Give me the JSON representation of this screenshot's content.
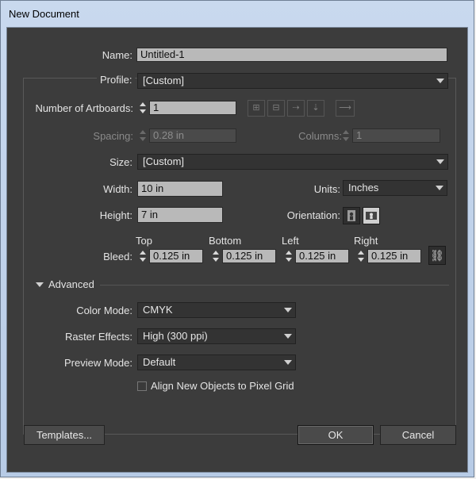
{
  "window": {
    "title": "New Document"
  },
  "name": {
    "label": "Name:",
    "value": "Untitled-1"
  },
  "profile": {
    "label": "Profile:",
    "value": "[Custom]"
  },
  "artboards": {
    "label": "Number of Artboards:",
    "value": "1"
  },
  "spacing": {
    "label": "Spacing:",
    "value": "0.28 in"
  },
  "columns": {
    "label": "Columns:",
    "value": "1"
  },
  "size": {
    "label": "Size:",
    "value": "[Custom]"
  },
  "width": {
    "label": "Width:",
    "value": "10 in"
  },
  "units": {
    "label": "Units:",
    "value": "Inches"
  },
  "height": {
    "label": "Height:",
    "value": "7 in"
  },
  "orientation": {
    "label": "Orientation:"
  },
  "bleed": {
    "label": "Bleed:",
    "top_label": "Top",
    "top": "0.125 in",
    "bottom_label": "Bottom",
    "bottom": "0.125 in",
    "left_label": "Left",
    "left": "0.125 in",
    "right_label": "Right",
    "right": "0.125 in"
  },
  "advanced": {
    "label": "Advanced"
  },
  "color_mode": {
    "label": "Color Mode:",
    "value": "CMYK"
  },
  "raster_effects": {
    "label": "Raster Effects:",
    "value": "High (300 ppi)"
  },
  "preview_mode": {
    "label": "Preview Mode:",
    "value": "Default"
  },
  "align_grid": {
    "label": "Align New Objects to Pixel Grid",
    "checked": false
  },
  "buttons": {
    "templates": "Templates...",
    "ok": "OK",
    "cancel": "Cancel"
  },
  "colors": {
    "dialog_bg": "#3c3c3c",
    "field_bg": "#b9b9b9",
    "titlebar": "#c9d9ee"
  }
}
